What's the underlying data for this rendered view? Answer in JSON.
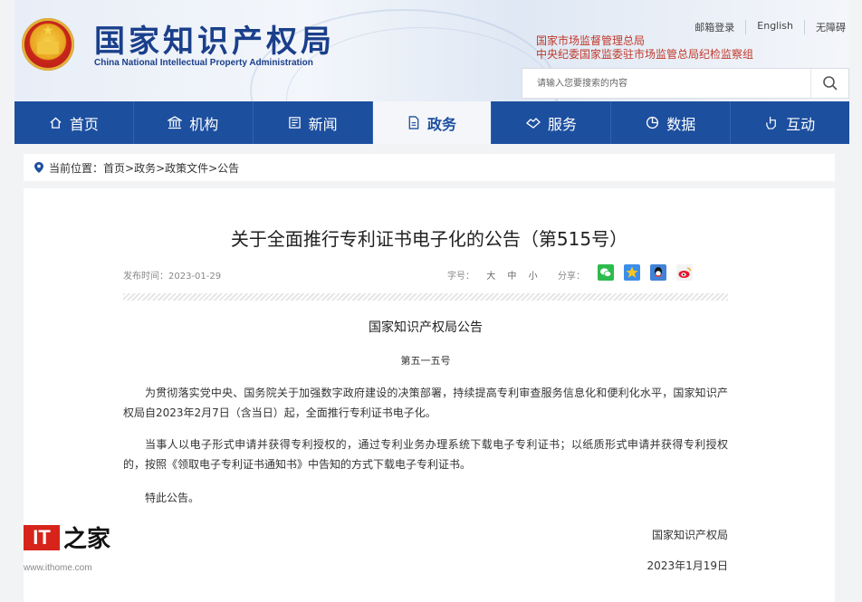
{
  "header": {
    "brand_cn": "国家知识产权局",
    "brand_en": "China National Intellectual Property Administration",
    "top_links": [
      "邮箱登录",
      "English",
      "无障碍"
    ],
    "org_links": [
      "国家市场监督管理总局",
      "中央纪委国家监委驻市场监管总局纪检监察组"
    ],
    "search_placeholder": "请输入您要搜索的内容"
  },
  "nav": {
    "items": [
      {
        "label": "首页",
        "icon": "home-icon"
      },
      {
        "label": "机构",
        "icon": "institution-icon"
      },
      {
        "label": "新闻",
        "icon": "news-icon"
      },
      {
        "label": "政务",
        "icon": "document-icon",
        "active": true
      },
      {
        "label": "服务",
        "icon": "service-icon"
      },
      {
        "label": "数据",
        "icon": "chart-icon"
      },
      {
        "label": "互动",
        "icon": "interaction-icon"
      }
    ],
    "colors": {
      "bar": "#1d4f9f",
      "active_bg": "#f4f6f9"
    }
  },
  "breadcrumb": {
    "label": "当前位置：",
    "path": "首页>政务>政策文件>公告"
  },
  "article": {
    "title": "关于全面推行专利证书电子化的公告（第515号）",
    "date": "发布时间：2023-01-29",
    "font_size_label": "字号：",
    "font_sizes": [
      "大",
      "中",
      "小"
    ],
    "share_label": "分享：",
    "share_icons": [
      "wechat-icon",
      "qzone-icon",
      "qq-icon",
      "weibo-icon"
    ],
    "announcement_title": "国家知识产权局公告",
    "announcement_no": "第五一五号",
    "paragraphs": [
      "为贯彻落实党中央、国务院关于加强数字政府建设的决策部署，持续提高专利审查服务信息化和便利化水平，国家知识产权局自2023年2月7日（含当日）起，全面推行专利证书电子化。",
      "当事人以电子形式申请并获得专利授权的，通过专利业务办理系统下载电子专利证书；以纸质形式申请并获得专利授权的，按照《领取电子专利证书通知书》中告知的方式下载电子专利证书。",
      "特此公告。"
    ],
    "signature": "国家知识产权局",
    "signature_date": "2023年1月19日"
  },
  "watermark": {
    "logo_text": "IT",
    "logo_cn": "之家",
    "url": "www.ithome.com"
  }
}
